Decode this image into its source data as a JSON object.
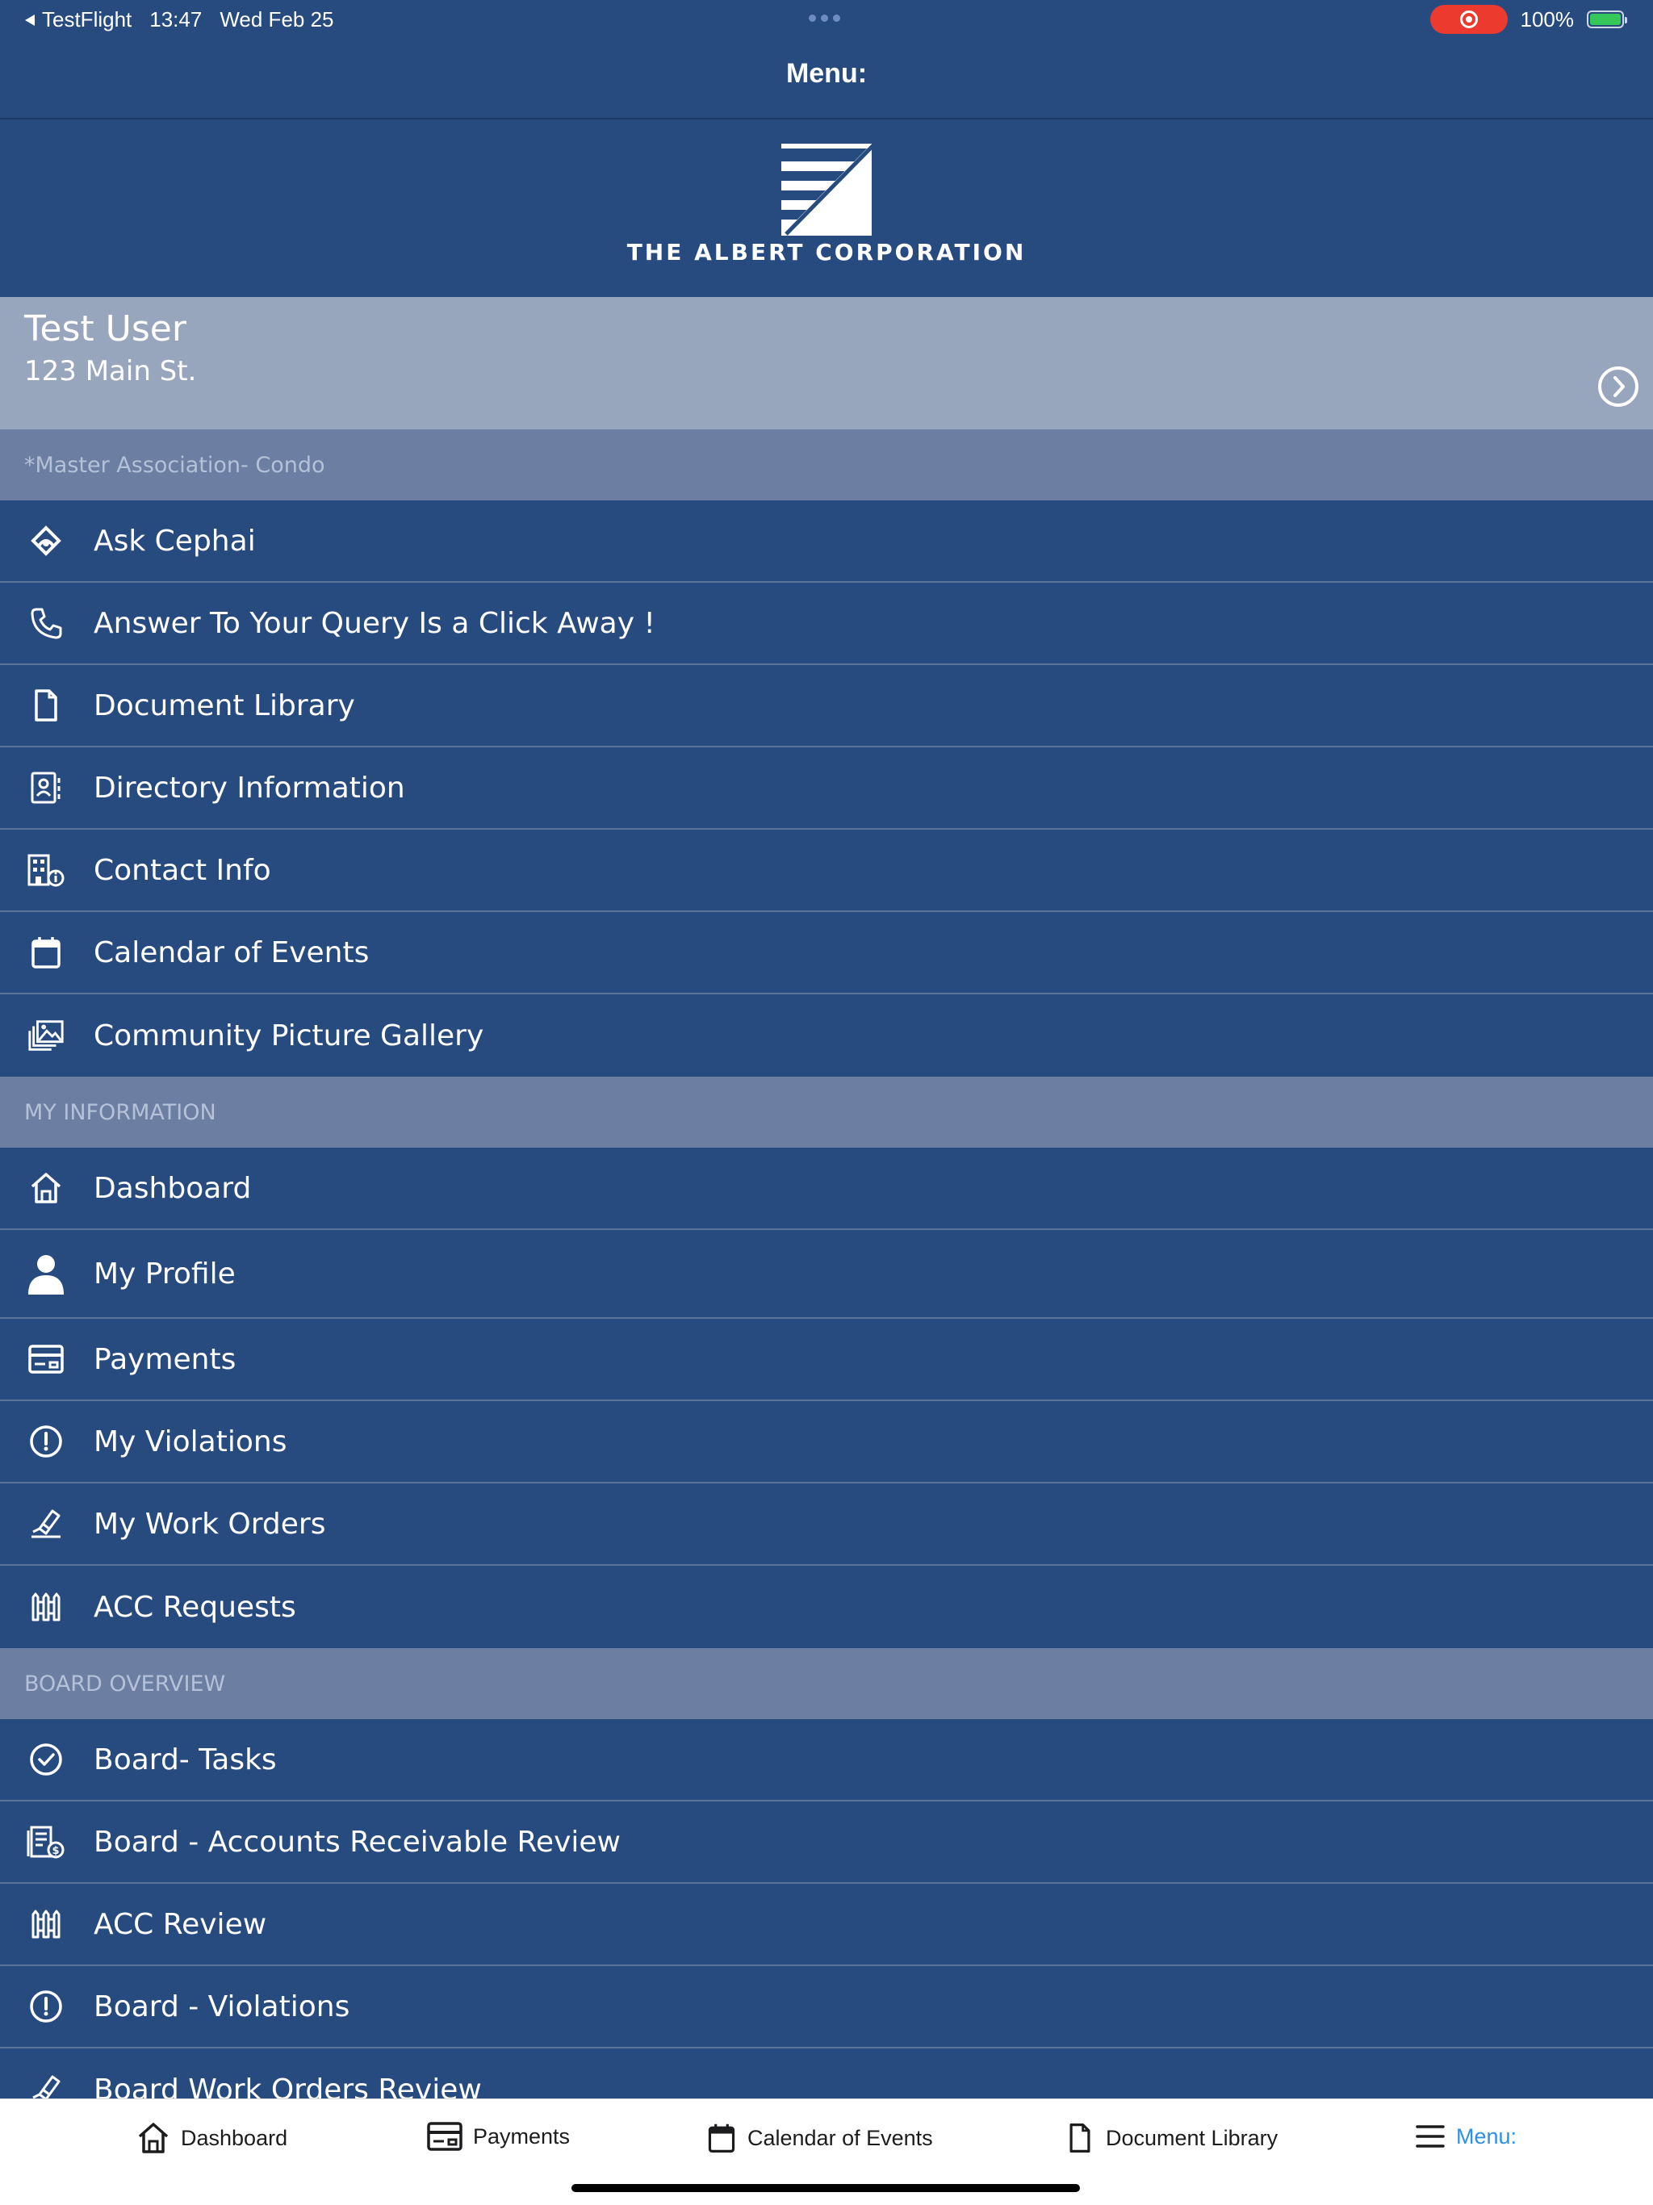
{
  "status_bar": {
    "back_app": "TestFlight",
    "time": "13:47",
    "date": "Wed Feb 25",
    "battery": "100%"
  },
  "nav": {
    "title": "Menu:"
  },
  "brand": {
    "logo_text": "THE ALBERT CORPORATION"
  },
  "user": {
    "name": "Test User",
    "address": "123 Main St."
  },
  "association": {
    "label": "*Master Association- Condo"
  },
  "association_items": [
    {
      "label": "Ask Cephai",
      "icon": "ask-cephai-icon"
    },
    {
      "label": "Answer To Your Query Is a Click Away !",
      "icon": "phone-icon"
    },
    {
      "label": "Document Library",
      "icon": "document-icon"
    },
    {
      "label": "Directory Information",
      "icon": "directory-icon"
    },
    {
      "label": "Contact Info",
      "icon": "building-info-icon"
    },
    {
      "label": "Calendar of Events",
      "icon": "calendar-icon"
    },
    {
      "label": "Community Picture Gallery",
      "icon": "gallery-icon"
    }
  ],
  "my_information": {
    "header": "MY INFORMATION",
    "items": [
      {
        "label": "Dashboard",
        "icon": "home-icon"
      },
      {
        "label": "My Profile",
        "icon": "person-icon"
      },
      {
        "label": "Payments",
        "icon": "payment-card-icon"
      },
      {
        "label": "My Violations",
        "icon": "alert-circle-icon"
      },
      {
        "label": "My Work Orders",
        "icon": "work-order-icon"
      },
      {
        "label": "ACC Requests",
        "icon": "fence-icon"
      }
    ]
  },
  "board_overview": {
    "header": "BOARD OVERVIEW",
    "items": [
      {
        "label": "Board- Tasks",
        "icon": "check-circle-icon"
      },
      {
        "label": "Board - Accounts Receivable Review",
        "icon": "receivable-icon"
      },
      {
        "label": "ACC Review",
        "icon": "fence-icon"
      },
      {
        "label": "Board - Violations",
        "icon": "alert-circle-icon"
      },
      {
        "label": "Board Work Orders Review",
        "icon": "work-order-icon"
      }
    ]
  },
  "tabbar": {
    "tabs": [
      {
        "label": "Dashboard",
        "icon": "home-icon"
      },
      {
        "label": "Payments",
        "icon": "payment-card-icon"
      },
      {
        "label": "Calendar of Events",
        "icon": "calendar-icon"
      },
      {
        "label": "Document Library",
        "icon": "document-icon"
      },
      {
        "label": "Menu:",
        "icon": "hamburger-icon",
        "active": true
      }
    ]
  },
  "colors": {
    "primary": "#274a7f",
    "user_card": "#97a5bd",
    "section_header": "#6c7fa2",
    "tab_active": "#2f8fe2",
    "record_indicator": "#ec3a2f",
    "battery": "#35c759"
  }
}
